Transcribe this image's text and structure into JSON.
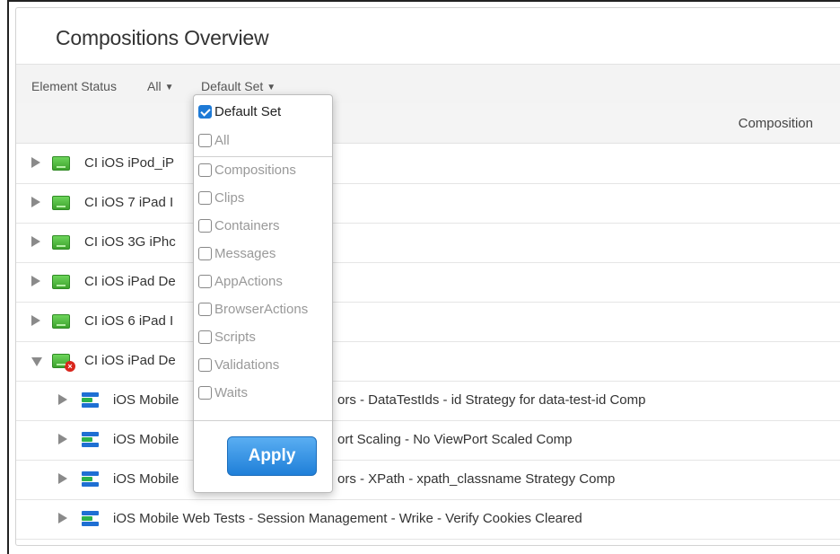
{
  "title": "Compositions Overview",
  "filters": {
    "element_status_label": "Element Status",
    "element_status_value": "All",
    "set_value": "Default Set"
  },
  "table": {
    "column_header": "Composition",
    "rows": [
      {
        "text": "CI iOS iPod_iP",
        "type": "suite",
        "expanded": false,
        "error": false
      },
      {
        "text": "CI iOS 7 iPad I",
        "type": "suite",
        "expanded": false,
        "error": false
      },
      {
        "text": "CI iOS 3G iPhc",
        "type": "suite",
        "expanded": false,
        "error": false
      },
      {
        "text": "CI iOS iPad De",
        "type": "suite",
        "expanded": false,
        "error": false
      },
      {
        "text": "CI iOS 6 iPad I",
        "type": "suite",
        "expanded": false,
        "error": false
      },
      {
        "text": "CI iOS iPad De",
        "type": "suite",
        "expanded": true,
        "error": true
      },
      {
        "text": "iOS Mobile",
        "tail": "ors - DataTestIds - id Strategy for data-test-id Comp",
        "type": "composition"
      },
      {
        "text": "iOS Mobile",
        "tail": "ort Scaling - No ViewPort Scaled Comp",
        "type": "composition"
      },
      {
        "text": "iOS Mobile",
        "tail": "ors - XPath - xpath_classname Strategy Comp",
        "type": "composition"
      },
      {
        "text": "iOS Mobile Web Tests - Session Management - Wrike - Verify Cookies Cleared",
        "type": "composition"
      }
    ]
  },
  "dropdown": {
    "options": [
      {
        "label": "Default Set",
        "checked": true
      },
      {
        "label": "All",
        "checked": false
      },
      {
        "label": "Compositions",
        "checked": false
      },
      {
        "label": "Clips",
        "checked": false
      },
      {
        "label": "Containers",
        "checked": false
      },
      {
        "label": "Messages",
        "checked": false
      },
      {
        "label": "AppActions",
        "checked": false
      },
      {
        "label": "BrowserActions",
        "checked": false
      },
      {
        "label": "Scripts",
        "checked": false
      },
      {
        "label": "Validations",
        "checked": false
      },
      {
        "label": "Waits",
        "checked": false
      }
    ],
    "apply_label": "Apply"
  },
  "colors": {
    "accent": "#1e7ad6",
    "suite_green": "#3da22d",
    "error_red": "#d9261c"
  }
}
